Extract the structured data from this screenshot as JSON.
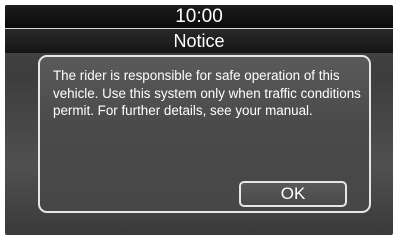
{
  "status_bar": {
    "clock": "10:00"
  },
  "dialog": {
    "title": "Notice",
    "message": "The rider is responsible for safe operation of this vehicle. Use this system only when traffic conditions permit. For further details, see your manual.",
    "ok_label": "OK"
  },
  "colors": {
    "background": "#444444",
    "header": "#111111",
    "text": "#ffffff",
    "border": "#e6e6e6"
  }
}
